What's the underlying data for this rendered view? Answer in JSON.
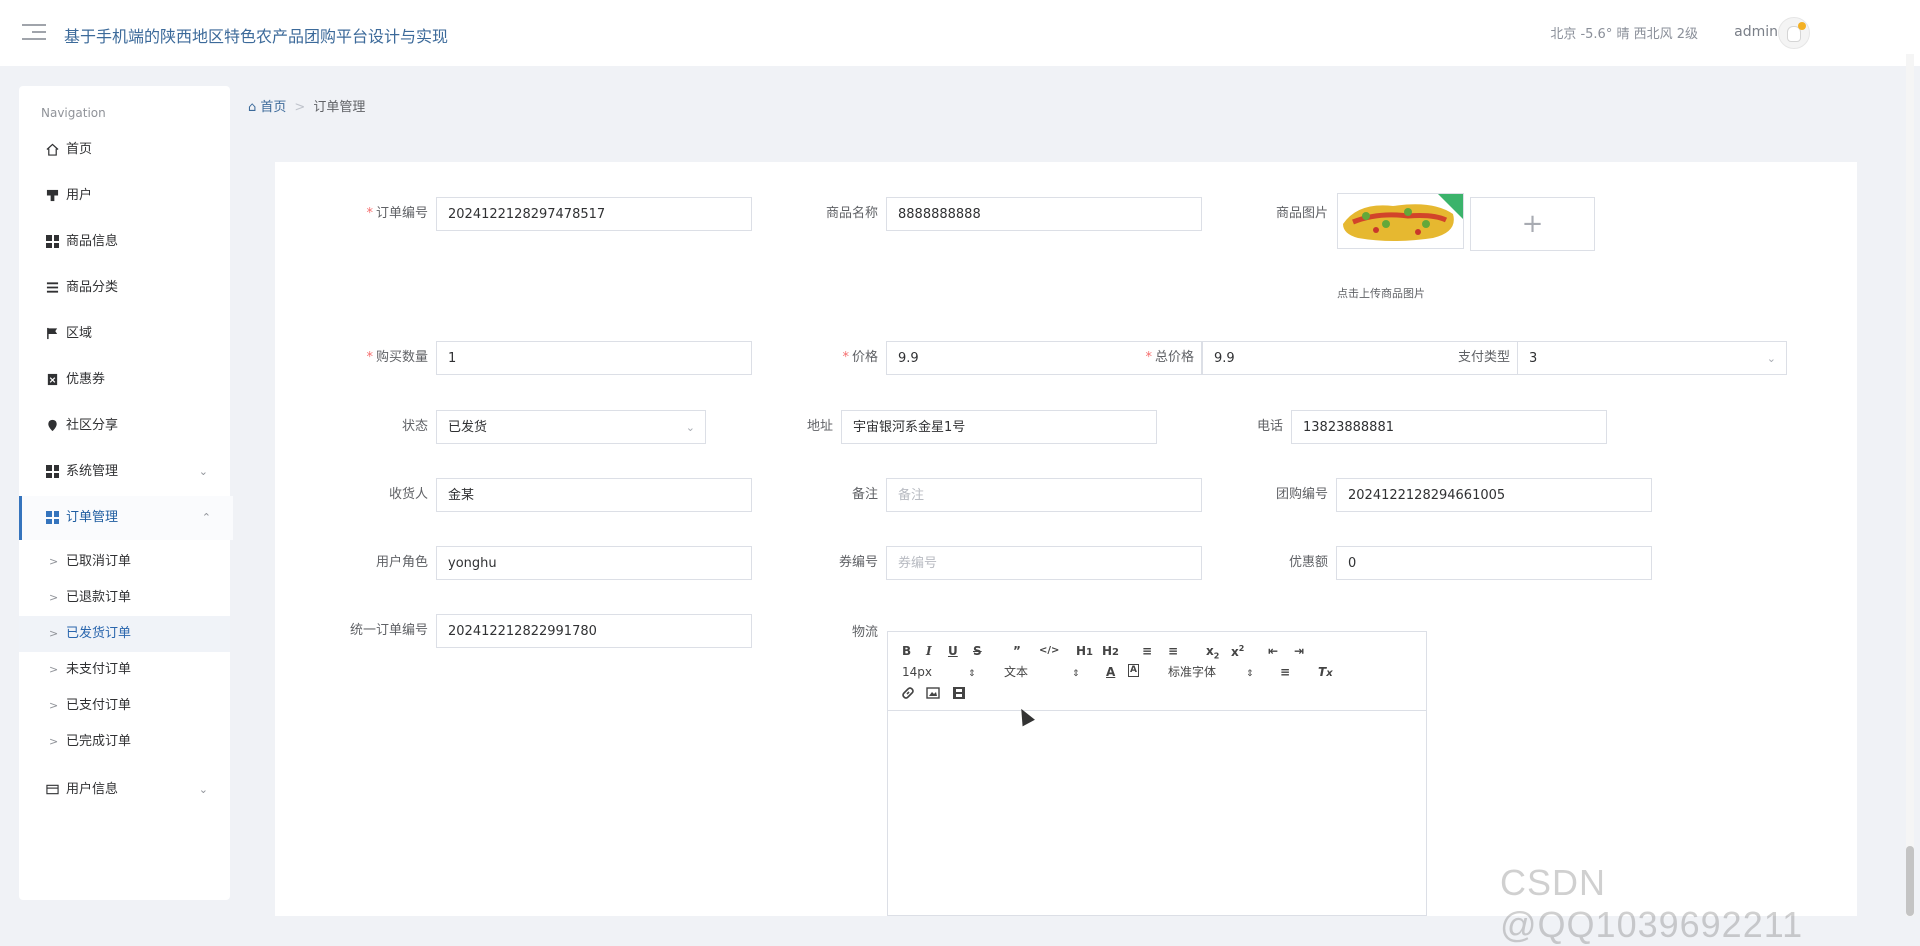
{
  "header": {
    "title": "基于手机端的陕西地区特色农产品团购平台设计与实现",
    "weather": "北京  -5.6°  晴  西北风  2级",
    "username": "admin"
  },
  "sidebar": {
    "caption": "Navigation",
    "items": [
      {
        "label": "首页",
        "icon": "home-icon"
      },
      {
        "label": "用户",
        "icon": "user-icon"
      },
      {
        "label": "商品信息",
        "icon": "grid-icon"
      },
      {
        "label": "商品分类",
        "icon": "list-icon"
      },
      {
        "label": "区域",
        "icon": "flag-icon"
      },
      {
        "label": "优惠券",
        "icon": "coupon-icon"
      },
      {
        "label": "社区分享",
        "icon": "pin-icon"
      },
      {
        "label": "系统管理",
        "icon": "grid-icon"
      },
      {
        "label": "订单管理",
        "icon": "grid-icon"
      },
      {
        "label": "用户信息",
        "icon": "card-icon"
      }
    ],
    "order_sub": [
      "已取消订单",
      "已退款订单",
      "已发货订单",
      "未支付订单",
      "已支付订单",
      "已完成订单"
    ]
  },
  "breadcrumb": {
    "home": "首页",
    "sep": ">",
    "current": "订单管理"
  },
  "form": {
    "order_no": {
      "label": "订单编号",
      "value": "2024122128297478517"
    },
    "product_name": {
      "label": "商品名称",
      "value": "8888888888"
    },
    "product_image": {
      "label": "商品图片",
      "hint": "点击上传商品图片",
      "plus": "+"
    },
    "quantity": {
      "label": "购买数量",
      "value": "1"
    },
    "price": {
      "label": "价格",
      "value": "9.9"
    },
    "total_price": {
      "label": "总价格",
      "value": "9.9"
    },
    "pay_type": {
      "label": "支付类型",
      "value": "3"
    },
    "status": {
      "label": "状态",
      "value": "已发货"
    },
    "address": {
      "label": "地址",
      "value": "宇宙银河系金星1号"
    },
    "phone": {
      "label": "电话",
      "value": "13823888881"
    },
    "receiver": {
      "label": "收货人",
      "value": "金某"
    },
    "remark": {
      "label": "备注",
      "placeholder": "备注"
    },
    "group_no": {
      "label": "团购编号",
      "value": "2024122128294661005"
    },
    "user_role": {
      "label": "用户角色",
      "value": "yonghu"
    },
    "coupon_no": {
      "label": "券编号",
      "placeholder": "券编号"
    },
    "discount": {
      "label": "优惠额",
      "value": "0"
    },
    "unified_no": {
      "label": "统一订单编号",
      "value": "202412212822991780"
    },
    "logistics": {
      "label": "物流"
    }
  },
  "editor": {
    "font_size": "14px",
    "block_type": "文本",
    "font_family": "标准字体"
  },
  "watermark": "CSDN @QQ1039692211"
}
